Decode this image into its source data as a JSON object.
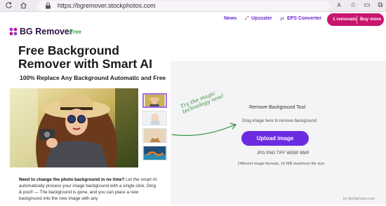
{
  "browser": {
    "url": "https://bgremover.stockphotos.com"
  },
  "header": {
    "logo_name": "BG Remover",
    "logo_badge": "Free",
    "nav": [
      {
        "label": "News"
      },
      {
        "label": "Upscaler"
      },
      {
        "label": "EPS Converter"
      }
    ],
    "removals_label": "1 removals",
    "buy_label": "Buy more",
    "colors": {
      "brand": "#c9166e",
      "accent": "#6b2be0",
      "badge": "#2eaa3c"
    }
  },
  "main": {
    "headline": "Free Background Remover with Smart AI",
    "subhead": "100% Replace Any Background Automatic and Free",
    "desc_bold": "Need to change the photo background in no time?",
    "desc_rest": " Let the smart AI automatically process your image background with a single click. Ding & poof! — The background is gone, and you can place a new background into the new image with any"
  },
  "tool": {
    "try_note": "Try the magic technology now!",
    "title": "Remove Background Tool",
    "hint": "Drag image here to remove background",
    "upload_label": "Upload image",
    "formats": "JPG PNG TIFF WEBP BMP",
    "formats_note": "Different image formats, 10 MB maximum file size",
    "credit": "by Stockphotos.com"
  }
}
